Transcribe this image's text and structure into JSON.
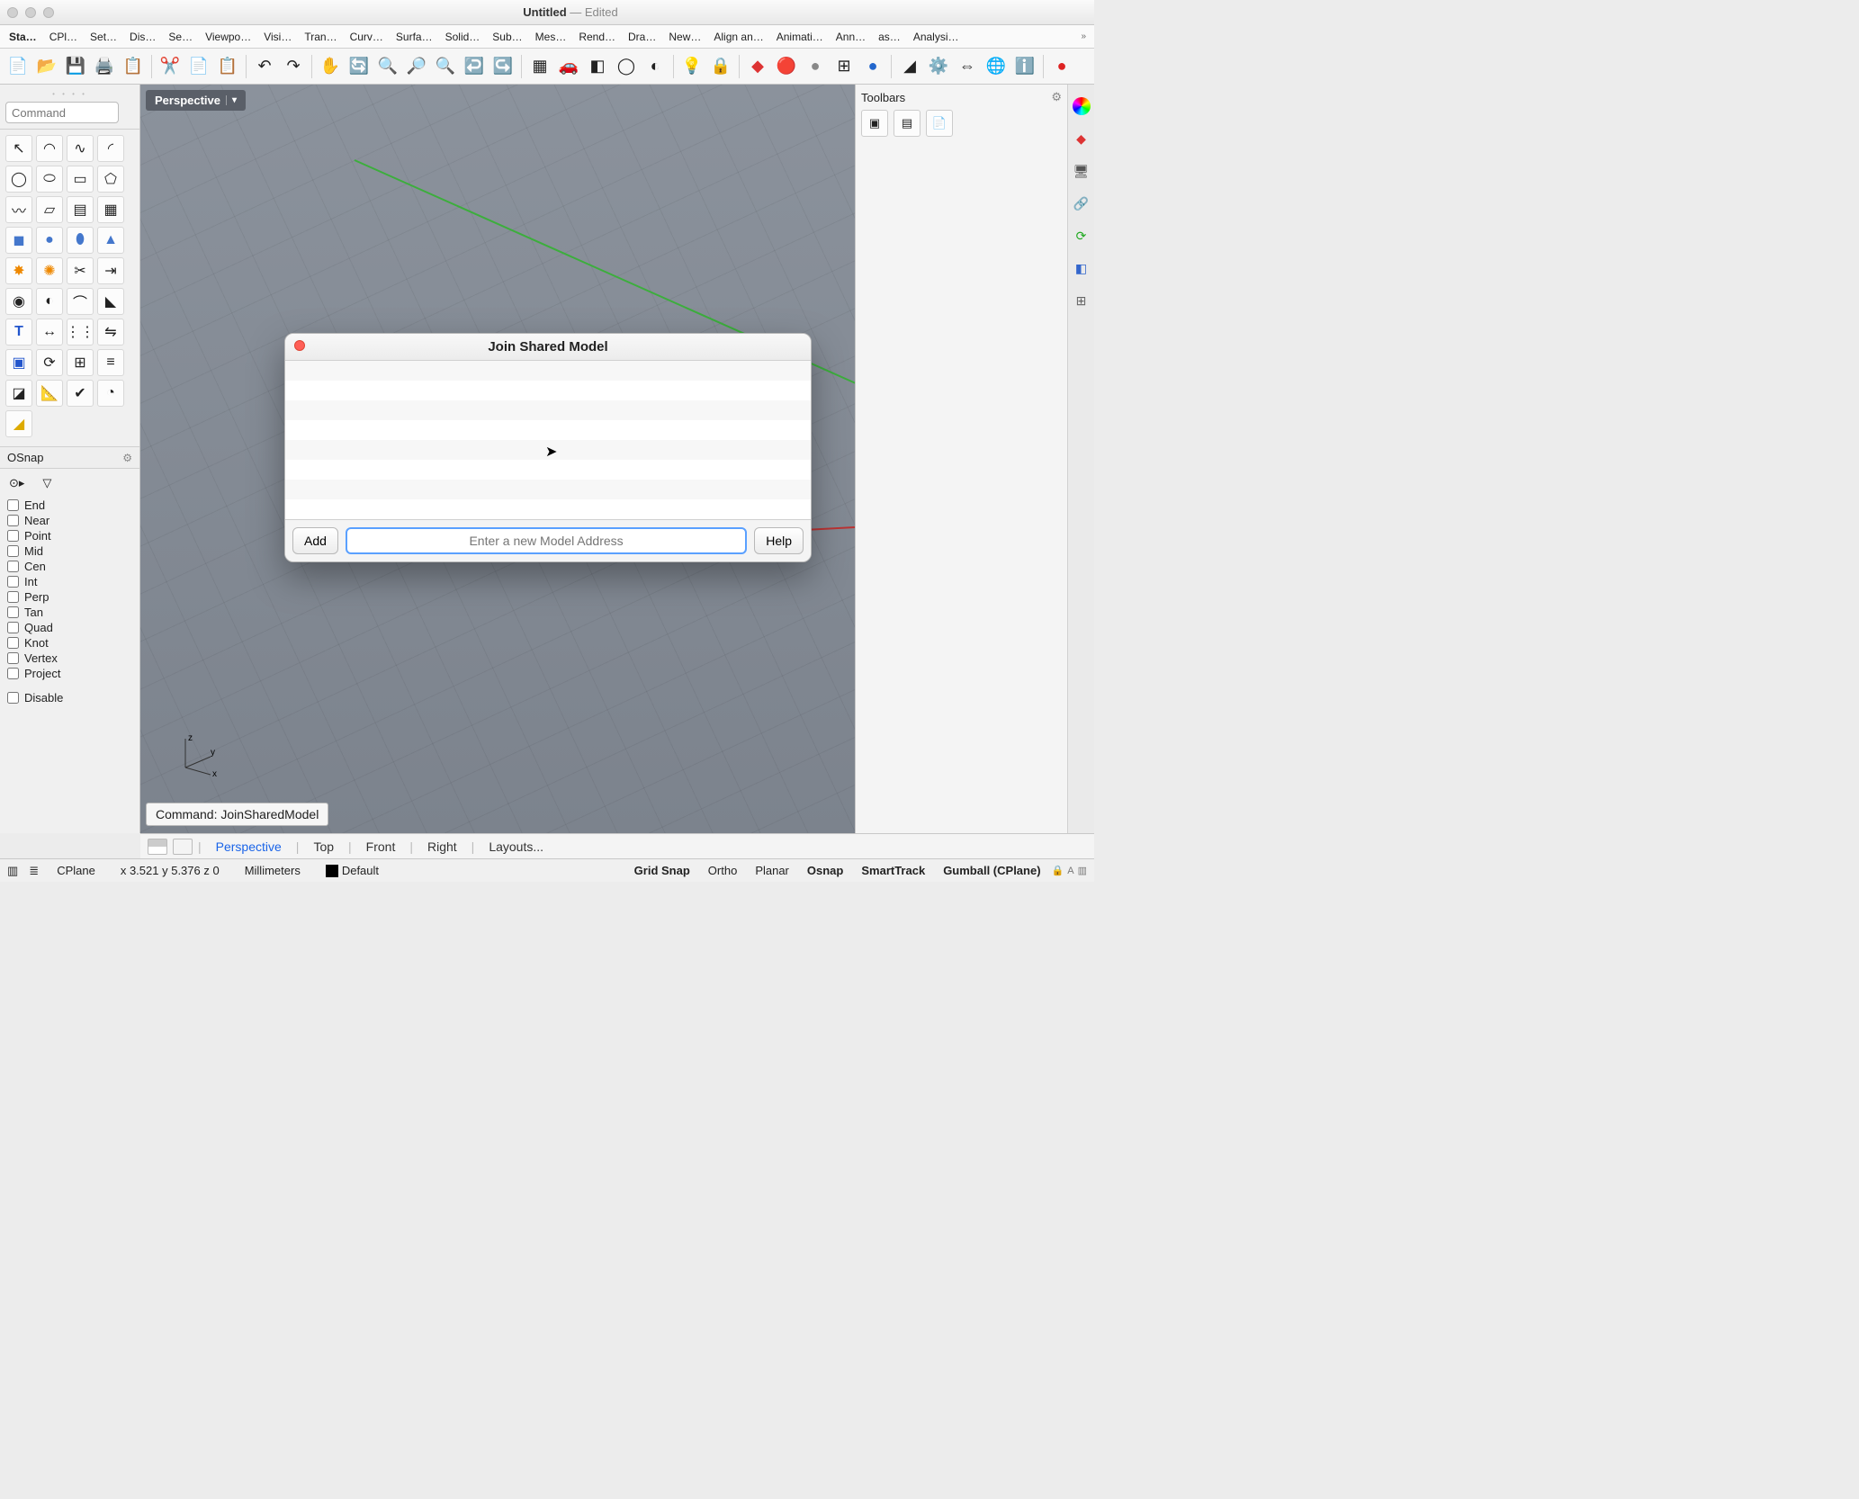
{
  "window": {
    "title": "Untitled",
    "subtitle": "— Edited"
  },
  "menubar": [
    "Sta…",
    "CPl…",
    "Set…",
    "Dis…",
    "Se…",
    "Viewpo…",
    "Visi…",
    "Tran…",
    "Curv…",
    "Surfa…",
    "Solid…",
    "Sub…",
    "Mes…",
    "Rend…",
    "Dra…",
    "New…",
    "Align an…",
    "Animati…",
    "Ann…",
    "as…",
    "Analysi…"
  ],
  "toolbar_icons": [
    "new-file",
    "open-file",
    "save-file",
    "print",
    "clipboard",
    "cut",
    "copy",
    "paste",
    "undo",
    "redo",
    "pan-hand",
    "rotate-view",
    "zoom-window",
    "zoom-extents",
    "zoom-selected",
    "undo-view",
    "redo-view",
    "four-views",
    "car",
    "cplane",
    "circle",
    "layers",
    "light",
    "lock",
    "material-red",
    "material-rainbow",
    "material-gray",
    "material-grid",
    "material-globe",
    "wand",
    "gear",
    "dimension",
    "globe-help",
    "help",
    "elmo"
  ],
  "command_placeholder": "Command",
  "viewport": {
    "label": "Perspective",
    "command_line": "Command: JoinSharedModel"
  },
  "osnap": {
    "title": "OSnap",
    "items": [
      "End",
      "Near",
      "Point",
      "Mid",
      "Cen",
      "Int",
      "Perp",
      "Tan",
      "Quad",
      "Knot",
      "Vertex",
      "Project"
    ],
    "disable": "Disable"
  },
  "right_panel": {
    "title": "Toolbars"
  },
  "viewtabs": {
    "active": "Perspective",
    "tabs": [
      "Perspective",
      "Top",
      "Front",
      "Right",
      "Layouts..."
    ]
  },
  "status": {
    "cplane": "CPlane",
    "coords": "x 3.521  y 5.376  z 0",
    "units": "Millimeters",
    "layer": "Default",
    "toggles": [
      "Grid Snap",
      "Ortho",
      "Planar",
      "Osnap",
      "SmartTrack",
      "Gumball (CPlane)"
    ],
    "toggles_bold": [
      true,
      false,
      false,
      true,
      true,
      true
    ]
  },
  "dialog": {
    "title": "Join Shared Model",
    "add": "Add",
    "placeholder": "Enter a new Model Address",
    "help": "Help"
  }
}
